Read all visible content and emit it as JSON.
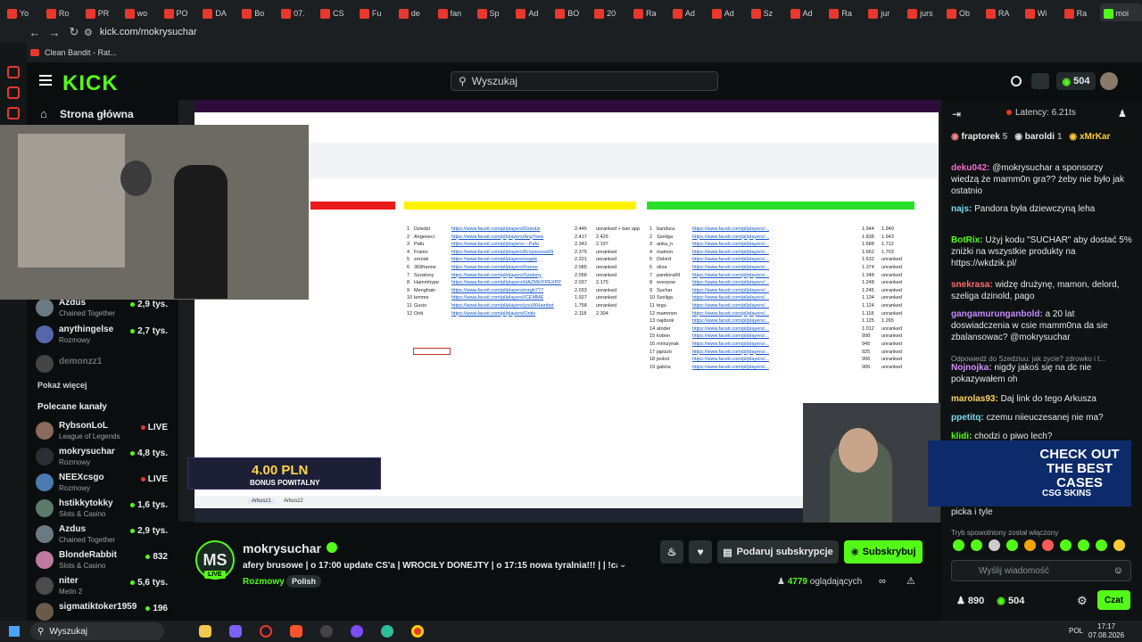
{
  "browser": {
    "tabs": [
      "Yo",
      "Ro",
      "PR",
      "wo",
      "PO",
      "DA",
      "Bo",
      "07.",
      "CS",
      "Fu",
      "de",
      "fan",
      "Sp",
      "Ad",
      "BO",
      "20",
      "Ra",
      "Ad",
      "Ad",
      "Sz",
      "Ad",
      "Ra",
      "jur",
      "jurs",
      "Ob",
      "RA",
      "Wi",
      "Ra",
      "moi"
    ],
    "url": "kick.com/mokrysuchar",
    "bookmark": "Clean Bandit - Rat..."
  },
  "kick": {
    "logo": "KICK",
    "search_placeholder": "Wyszukaj",
    "balance": "504",
    "home_label": "Strona główna"
  },
  "sidebar": {
    "followed": [
      {
        "name": "Azdus",
        "category": "Chained Together",
        "viewers": "2,9 tys."
      },
      {
        "name": "anythingelse",
        "category": "Rozmowy",
        "viewers": "2,7 tys."
      },
      {
        "name": "demonzz1",
        "category": "",
        "viewers": ""
      }
    ],
    "show_more": "Pokaż więcej",
    "recommended_title": "Polecane kanały",
    "recommended": [
      {
        "name": "RybsonLoL",
        "category": "League of Legends",
        "viewers": "LIVE"
      },
      {
        "name": "mokrysuchar",
        "category": "Rozmowy",
        "viewers": "4,8 tys."
      },
      {
        "name": "NEEXcsgo",
        "category": "Rozmowy",
        "viewers": "LIVE"
      },
      {
        "name": "hstikkytokky",
        "category": "Slots & Casino",
        "viewers": "1,6 tys."
      },
      {
        "name": "Azdus",
        "category": "Chained Together",
        "viewers": "2,9 tys."
      },
      {
        "name": "BlondeRabbit",
        "category": "Slots & Casino",
        "viewers": "832"
      },
      {
        "name": "niter",
        "category": "Metin 2",
        "viewers": "5,6 tys."
      },
      {
        "name": "sigmatiktoker1959",
        "category": "",
        "viewers": "196"
      }
    ]
  },
  "video": {
    "promo_amount": "4.00 PLN",
    "promo_label": "BONUS POWITALNY",
    "sheet_tabs": [
      "Arkusz1",
      "Arkusz2"
    ],
    "sheet_rows_left": [
      [
        "1",
        "Dziedzi",
        "https://www.faceit.com/pl/players/Dziedzi",
        "2.445",
        "unranked + ban app"
      ],
      [
        "2",
        "Angeeeci",
        "https://www.faceit.com/pl/players/AngTeee",
        "2.417",
        "2.425"
      ],
      [
        "3",
        "Pafu",
        "https://www.faceit.com/pl/players/---Pafu",
        "2.343",
        "2.197"
      ],
      [
        "4",
        "Franio",
        "https://www.faceit.com/pl/players/Krzywooos69",
        "2.375",
        "unranked"
      ],
      [
        "5",
        "zerosk",
        "https://www.faceit.com/pl/players/zegek",
        "2.221",
        "unranked"
      ],
      [
        "6",
        "369franne",
        "https://www.faceit.com/pl/players/franne",
        "2.085",
        "unranked"
      ],
      [
        "7",
        "Szzalony",
        "https://www.faceit.com/pl/players/Szalony",
        "2.058",
        "unranked"
      ],
      [
        "8",
        "Hammhype",
        "https://www.faceit.com/pl/players/HAZMHYPEXPP",
        "2.037",
        "2.175"
      ],
      [
        "9",
        "Menghain",
        "https://www.faceit.com/pl/players/mrgh777",
        "2.033",
        "unranked"
      ],
      [
        "10",
        "lemme",
        "https://www.faceit.com/pl/players/ICEMME",
        "1.927",
        "unranked"
      ],
      [
        "11",
        "Gucio",
        "https://www.faceit.com/pl/players/youWHambot",
        "1.758",
        "unranked"
      ],
      [
        "12",
        "Oriti",
        "https://www.faceit.com/pl/players/Oritis",
        "2.118",
        "2.304"
      ]
    ],
    "sheet_rows_right": [
      [
        "1",
        "bandura",
        "1.944",
        "1.949"
      ],
      [
        "2",
        "Szeliga",
        "1.838",
        "1.943"
      ],
      [
        "3",
        "anka_n",
        "1.688",
        "1.712"
      ],
      [
        "4",
        "mamon",
        "1.662",
        "1.703"
      ],
      [
        "5",
        "Delord",
        "1.632",
        "unranked"
      ],
      [
        "6",
        "oliza",
        "1.374",
        "unranked"
      ],
      [
        "7",
        "pandora99",
        "1.348",
        "unranked"
      ],
      [
        "8",
        "overpow",
        "1.248",
        "unranked"
      ],
      [
        "9",
        "Suchar",
        "1.245",
        "unranked"
      ],
      [
        "10",
        "Szeliga",
        "1.134",
        "unranked"
      ],
      [
        "11",
        "tegu",
        "1.124",
        "unranked"
      ],
      [
        "12",
        "mammon",
        "1.118",
        "unranked"
      ],
      [
        "13",
        "najdook",
        "1.125",
        "1.265"
      ],
      [
        "14",
        "atoder",
        "1.012",
        "unranked"
      ],
      [
        "15",
        "kobon",
        "998",
        "unranked"
      ],
      [
        "16",
        "mrinzynak",
        "945",
        "unranked"
      ],
      [
        "17",
        "japizzo",
        "925",
        "unranked"
      ],
      [
        "18",
        "jeskol",
        "906",
        "unranked"
      ],
      [
        "19",
        "galicia",
        "906",
        "unranked"
      ]
    ]
  },
  "stream": {
    "avatar": "MS",
    "live": "LIVE",
    "name": "mokrysuchar",
    "title": "afery brusowe | o 17:00 update CS'a | WRÓCIŁY DONEJTY | o 17:15 nowa tyralnia!!! | | !cas...",
    "category": "Rozmowy",
    "tag": "Polish",
    "gift_label": "Podaruj subskrypcje",
    "subscribe_label": "Subskrybuj",
    "viewers_count": "4779",
    "viewers_label": "oglądających"
  },
  "chat": {
    "latency": "Latency: 6.21ts",
    "top": [
      {
        "name": "fraptorek",
        "count": "5"
      },
      {
        "name": "baroldi",
        "count": "1"
      },
      {
        "name": "xMrKar",
        "count": ""
      }
    ],
    "messages": [
      {
        "user": "deku042:",
        "text": "@mokrysuchar a sponsorzy wiedzą że mamm0n gra?? żeby nie było jak ostatnio",
        "color": "#f26ccf"
      },
      {
        "user": "najs:",
        "text": "Pandora była dziewczyną leha",
        "color": "#7ad7f0"
      },
      {
        "user": "BotRix:",
        "text": "Użyj kodu \"SUCHAR\" aby dostać 5% zniżki na wszystkie produkty na https://wkdzik.pl/",
        "color": "#53fc18"
      },
      {
        "user": "snekrasa:",
        "text": "widzę drużynę, mamon, delord, szeliga dzinold, pago",
        "color": "#ff6b6b"
      },
      {
        "user": "gangamurunganbold:",
        "text": "a 20 lat doswiadczenia w csie mamm0na da sie zbalansowac? @mokrysuchar",
        "color": "#c58aff"
      },
      {
        "user": "Nojnojka:",
        "text": "nigdy jakoś się na dc nie pokazywałem oh",
        "color": "#d58cff"
      },
      {
        "user": "marolas93:",
        "text": "Daj link do tego Arkusza",
        "color": "#ffd166"
      },
      {
        "user": "ppetitq:",
        "text": "czemu niieuczesanej nie ma?",
        "color": "#7ad7f0"
      },
      {
        "user": "klidi:",
        "text": "chodzi o piwo lech?",
        "color": "#53fc18"
      }
    ],
    "reply_note": "Odpowiedź do Szedziuu: jak zycie? zdrowko i t...",
    "partial_line": "picka i tyle",
    "ad_title": "CHECK OUT THE BEST CASES",
    "ad_brand": "CSG SKINS",
    "slow_mode": "Tryb spowolniony został włączony",
    "input_placeholder": "Wyślij wiadomość",
    "points_a": "890",
    "points_b": "504",
    "send_label": "Czat"
  },
  "taskbar": {
    "search": "Wyszukaj",
    "lang": "POL",
    "time": "17:17",
    "date": "07.08.2026"
  },
  "colors": {
    "accent": "#53fc18",
    "background": "#0b0e0f"
  }
}
